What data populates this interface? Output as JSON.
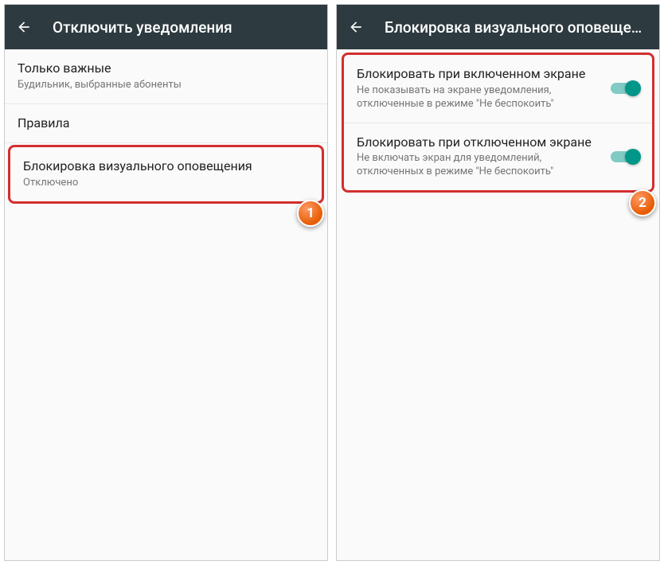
{
  "left": {
    "header_title": "Отключить уведомления",
    "item1": {
      "title": "Только важные",
      "subtitle": "Будильник, выбранные абоненты"
    },
    "item2": {
      "title": "Правила"
    },
    "item3": {
      "title": "Блокировка визуального оповещения",
      "subtitle": "Отключено"
    },
    "badge": "1"
  },
  "right": {
    "header_title": "Блокировка визуального оповеще…",
    "item1": {
      "title": "Блокировать при включенном экране",
      "subtitle": "Не показывать на экране уведомления, отключенные в режиме \"Не беспокоить\""
    },
    "item2": {
      "title": "Блокировать при отключенном экране",
      "subtitle": "Не включать экран для уведомлений, отключенных в режиме \"Не беспокоить\""
    },
    "badge": "2"
  }
}
